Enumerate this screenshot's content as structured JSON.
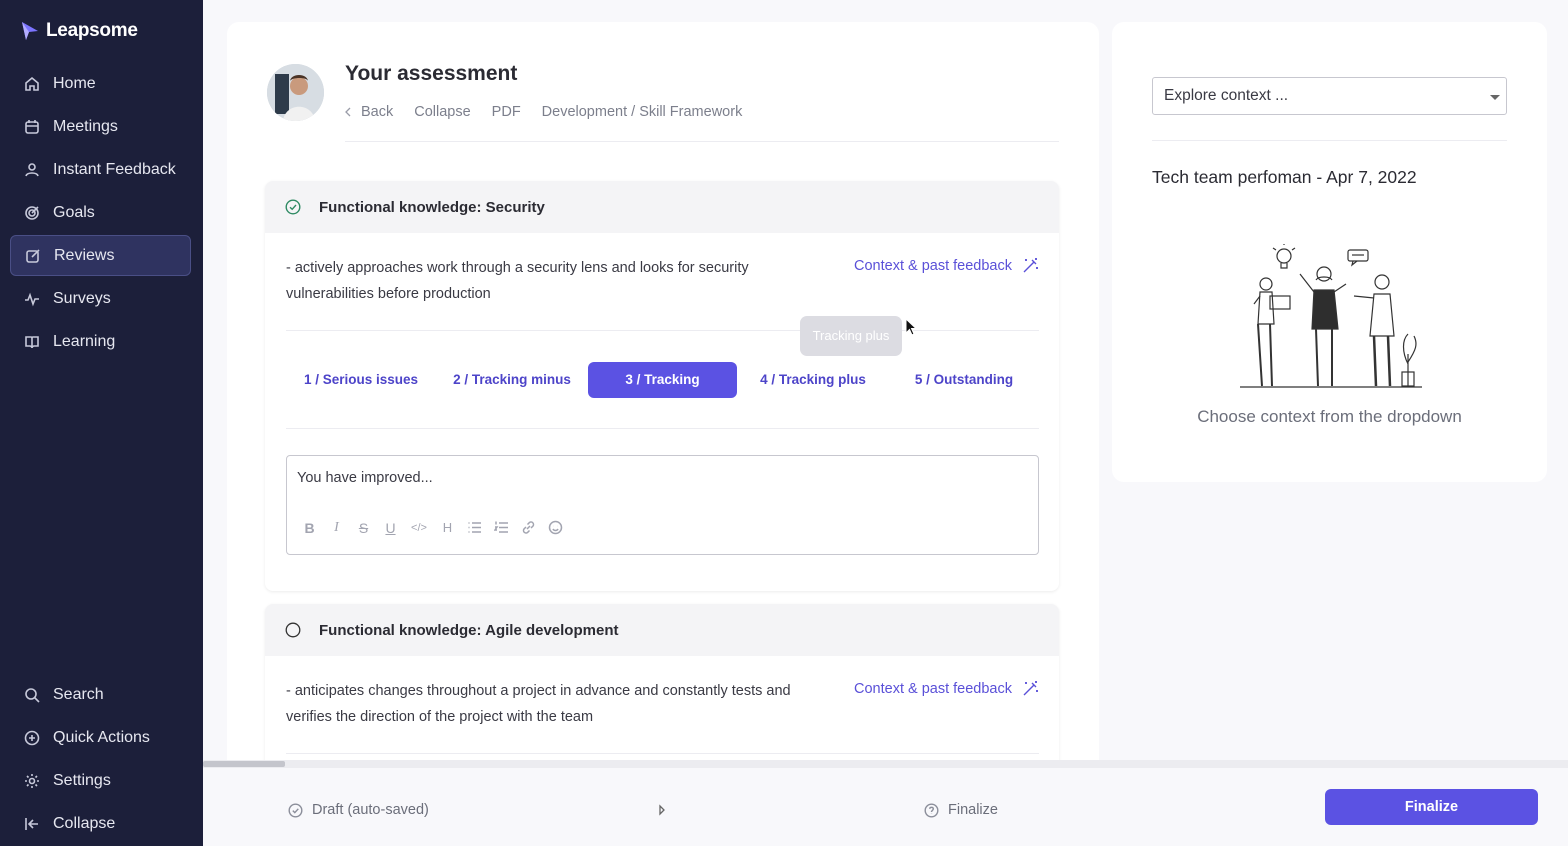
{
  "app": {
    "name": "Leapsome"
  },
  "sidebar": {
    "items": [
      {
        "label": "Home",
        "icon": "home-icon"
      },
      {
        "label": "Meetings",
        "icon": "calendar-icon"
      },
      {
        "label": "Instant Feedback",
        "icon": "feedback-icon"
      },
      {
        "label": "Goals",
        "icon": "target-icon"
      },
      {
        "label": "Reviews",
        "icon": "edit-icon",
        "active": true
      },
      {
        "label": "Surveys",
        "icon": "pulse-icon"
      },
      {
        "label": "Learning",
        "icon": "book-icon"
      }
    ],
    "bottom_items": [
      {
        "label": "Search",
        "icon": "search-icon"
      },
      {
        "label": "Quick Actions",
        "icon": "plus-circle-icon"
      },
      {
        "label": "Settings",
        "icon": "gear-icon"
      },
      {
        "label": "Collapse",
        "icon": "collapse-icon"
      }
    ]
  },
  "assessment": {
    "title": "Your assessment",
    "subnav": {
      "back": "Back",
      "collapse": "Collapse",
      "pdf": "PDF",
      "framework": "Development / Skill Framework"
    }
  },
  "sections": [
    {
      "title": "Functional knowledge: Security",
      "status": "completed",
      "description": "- actively approaches work through a security lens and looks for security vulnerabilities before production",
      "context_link": "Context & past feedback",
      "ratings": [
        "1 / Serious issues",
        "2 / Tracking minus",
        "3 / Tracking",
        "4 / Tracking plus",
        "5 / Outstanding"
      ],
      "selected_rating": "3 / Tracking",
      "tooltip": "Tracking plus",
      "editor_text": "You have improved..."
    },
    {
      "title": "Functional knowledge: Agile development",
      "status": "pending",
      "description": "- anticipates changes throughout a project in advance and constantly tests and verifies the direction of the project with the team",
      "context_link": "Context & past feedback"
    }
  ],
  "toolbar": [
    "B",
    "I",
    "S",
    "U",
    "</>",
    "H",
    "bulleted-list",
    "numbered-list",
    "link",
    "emoji"
  ],
  "context_panel": {
    "select_value": "Explore context ...",
    "title": "Tech team perfoman - Apr 7, 2022",
    "empty_text": "Choose context from the dropdown"
  },
  "footer": {
    "draft_label": "Draft (auto-saved)",
    "finalize_step": "Finalize",
    "finalize_button": "Finalize"
  },
  "colors": {
    "accent": "#5b52e3",
    "sidebar_bg": "#1c1f3a",
    "link": "#5a50d8"
  }
}
